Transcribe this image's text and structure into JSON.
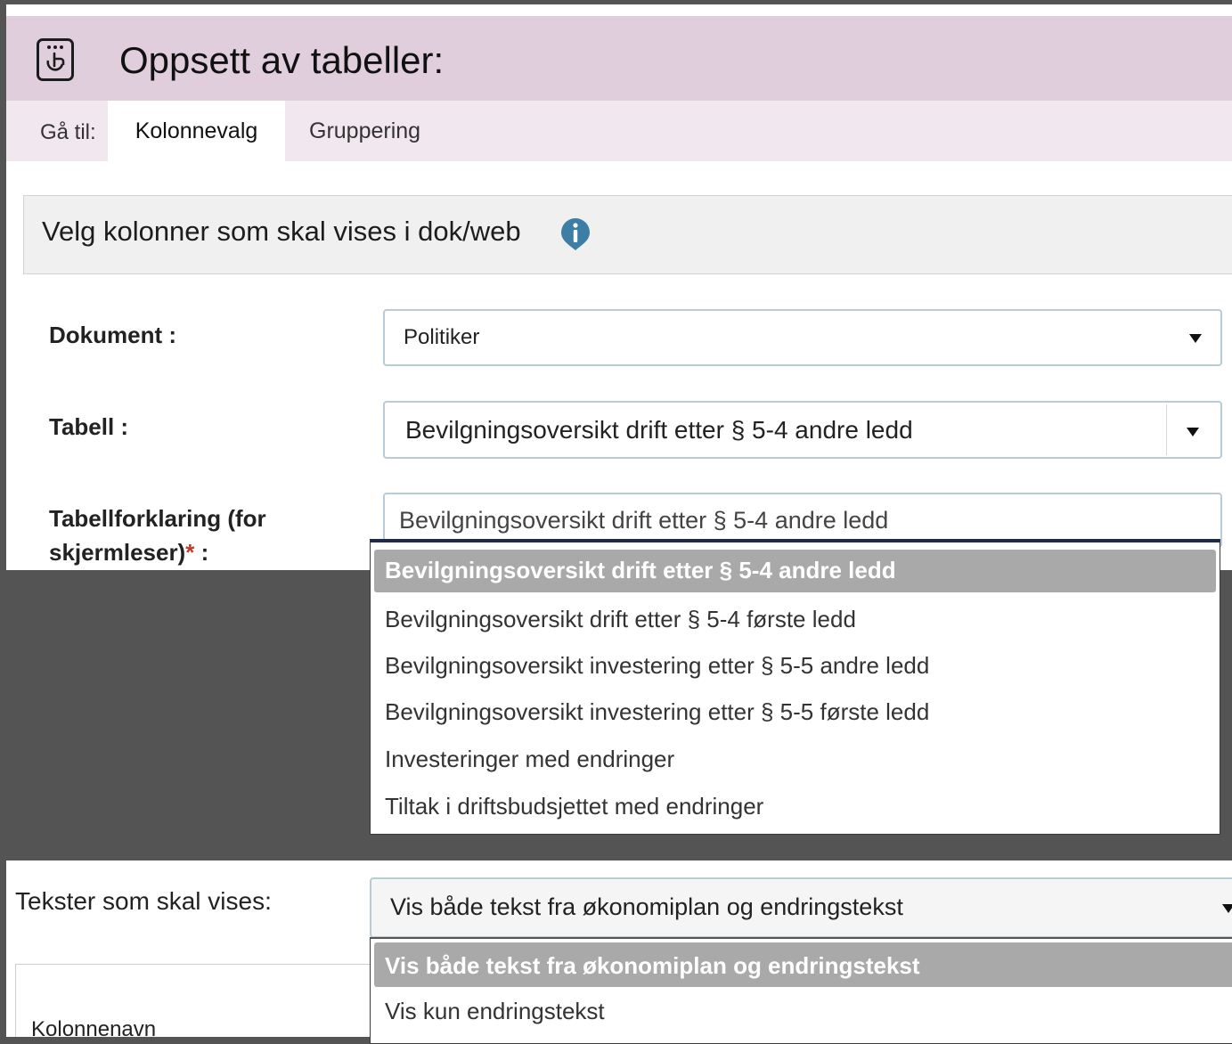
{
  "header": {
    "title": "Oppsett av tabeller:",
    "icon": "hand-touch-icon"
  },
  "nav": {
    "label": "Gå til:",
    "tabs": [
      {
        "label": "Kolonnevalg",
        "active": true
      },
      {
        "label": "Gruppering",
        "active": false
      }
    ]
  },
  "section": {
    "title": "Velg kolonner som skal vises i dok/web",
    "info_icon": "info-icon",
    "info_color": "#3d7ea6"
  },
  "form": {
    "dokument": {
      "label": "Dokument :",
      "value": "Politiker"
    },
    "tabell": {
      "label": "Tabell :",
      "value": "Bevilgningsoversikt drift etter § 5-4 andre ledd"
    },
    "tabellforklaring": {
      "label_line1": "Tabellforklaring (for",
      "label_line2": "skjermleser)",
      "required_mark": "*",
      "label_suffix": " :",
      "value": "Bevilgningsoversikt drift etter § 5-4 andre ledd"
    }
  },
  "tabell_dropdown": {
    "options": [
      "Bevilgningsoversikt drift etter § 5-4 andre ledd",
      "Bevilgningsoversikt drift etter § 5-4 første ledd",
      "Bevilgningsoversikt investering etter § 5-5 andre ledd",
      "Bevilgningsoversikt investering etter § 5-5 første ledd",
      "Investeringer med endringer",
      "Tiltak i driftsbudsjettet med endringer"
    ],
    "selected_index": 0
  },
  "tekster": {
    "label": "Tekster som skal vises:",
    "value": "Vis både tekst fra økonomiplan og endringstekst",
    "options": [
      "Vis både tekst fra økonomiplan og endringstekst",
      "Vis kun endringstekst"
    ],
    "selected_index": 0
  },
  "table": {
    "column_header": "Kolonnenavn"
  },
  "colors": {
    "header_bg": "#e1cedd",
    "nav_bg": "#f1e7ef",
    "selected_option_bg": "#a9a9a9",
    "required": "#c0392b"
  }
}
